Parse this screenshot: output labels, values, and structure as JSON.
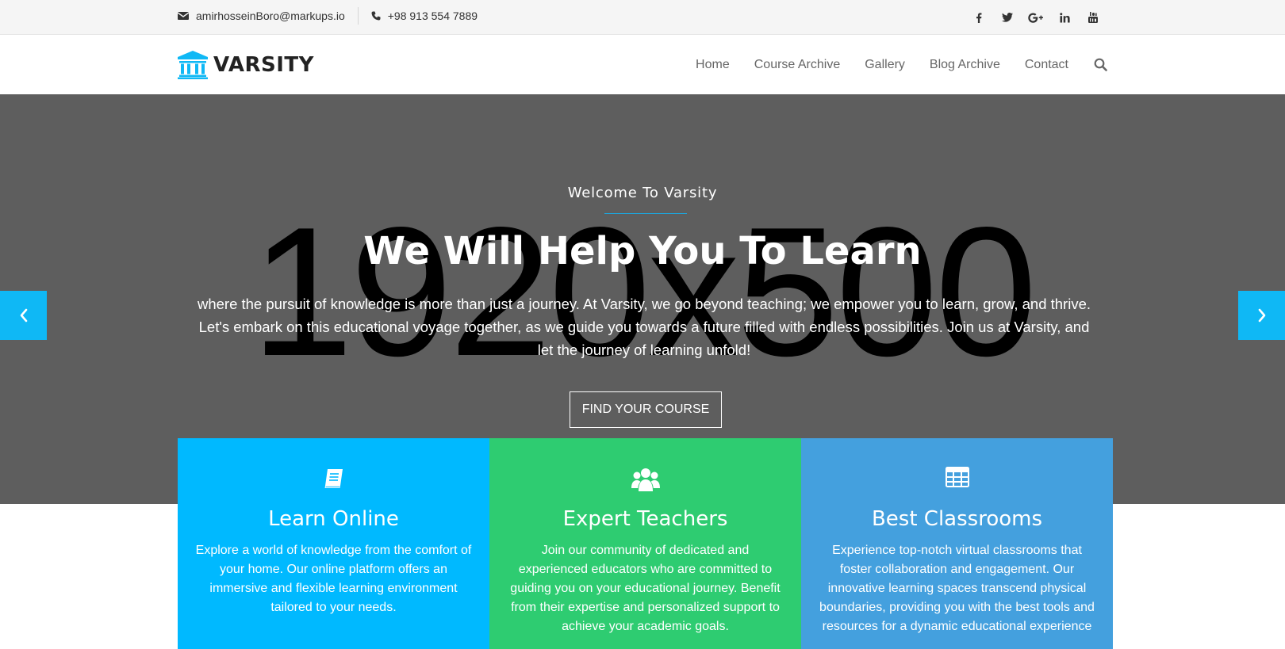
{
  "topbar": {
    "email": "amirhosseinBoro@markups.io",
    "phone": "+98 913 554 7889",
    "social": [
      "facebook-icon",
      "twitter-icon",
      "google-plus-icon",
      "linkedin-icon",
      "youtube-icon"
    ]
  },
  "header": {
    "logo_text": "VARSITY",
    "nav": [
      "Home",
      "Course Archive",
      "Gallery",
      "Blog Archive",
      "Contact"
    ]
  },
  "hero": {
    "placeholder": "1920x500",
    "welcome": "Welcome To Varsity",
    "title": "We Will Help You To Learn",
    "description": "where the pursuit of knowledge is more than just a journey. At Varsity, we go beyond teaching; we empower you to learn, grow, and thrive. Let's embark on this educational voyage together, as we guide you towards a future filled with endless possibilities. Join us at Varsity, and let the journey of learning unfold!",
    "cta": "FIND YOUR COURSE"
  },
  "features": [
    {
      "title": "Learn Online",
      "text": "Explore a world of knowledge from the comfort of your home. Our online platform offers an immersive and flexible learning environment tailored to your needs.",
      "color": "#00b9ff",
      "icon": "book-icon"
    },
    {
      "title": "Expert Teachers",
      "text": "Join our community of dedicated and experienced educators who are committed to guiding you on your educational journey. Benefit from their expertise and personalized support to achieve your academic goals.",
      "color": "#2ecc71",
      "icon": "users-icon"
    },
    {
      "title": "Best Classrooms",
      "text": "Experience top-notch virtual classrooms that foster collaboration and engagement. Our innovative learning spaces transcend physical boundaries, providing you with the best tools and resources for a dynamic educational experience",
      "color": "#44a0de",
      "icon": "table-icon"
    }
  ],
  "colors": {
    "accent": "#00b9ff",
    "hero_bg": "#5e5e5e",
    "green": "#2ecc71",
    "blue": "#44a0de"
  }
}
